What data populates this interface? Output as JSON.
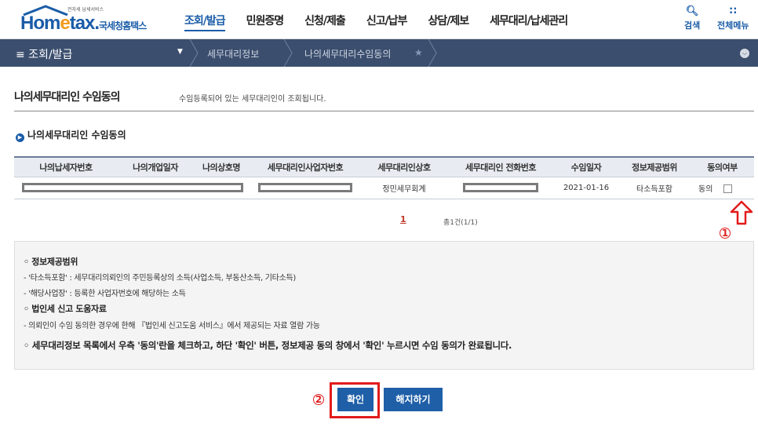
{
  "header": {
    "logo_small": "전자세 납세서비스",
    "logo_main_1": "Hom",
    "logo_main_e": "e",
    "logo_main_2": "tax.",
    "logo_sub": "국세청홈택스",
    "nav": [
      "조회/발급",
      "민원증명",
      "신청/제출",
      "신고/납부",
      "상담/제보",
      "세무대리/납세관리"
    ],
    "active_nav": "조회/발급",
    "search_label": "검색",
    "all_menu_label": "전체메뉴"
  },
  "navbar": {
    "menu_label": "≡  조회/발급",
    "crumb_1": "세무대리정보",
    "crumb_2": "나의세무대리수임동의"
  },
  "page": {
    "title": "나의세무대리인 수임동의",
    "title_desc": "수임등록되어 있는 세무대리인이 조회됩니다.",
    "section_title": "나의세무대리인 수임동의"
  },
  "table": {
    "headers": [
      "나의납세자번호",
      "나의개업일자",
      "나의상호명",
      "세무대리인사업자번호",
      "세무대리인상호",
      "세무대리인 전화번호",
      "수임일자",
      "정보제공범위",
      "동의여부"
    ],
    "row": {
      "agent_name": "정민세무회계",
      "date": "2021-01-16",
      "scope": "타소득포함",
      "consent": "동의"
    }
  },
  "pagination": {
    "page": "1",
    "total": "총1건(1/1)"
  },
  "info": {
    "h1": "◦ 정보제공범위",
    "l1": "- '타소득포함' : 세무대리의뢰인의 주민등록상의 소득(사업소득, 부동산소득, 기타소득)",
    "l2": "- '해당사업장' : 등록한 사업자번호에 해당하는 소득",
    "h2": "◦ 법인세 신고 도움자료",
    "l3": "- 의뢰인이 수임 동의한 경우에 한해 『법인세 신고도움 서비스』에서 제공되는 자료 열람 가능",
    "l4": "◦ 세무대리정보 목록에서 우측 '동의'란을 체크하고, 하단 '확인' 버튼, 정보제공 동의 창에서 '확인' 누르시면 수임 동의가 완료됩니다."
  },
  "buttons": {
    "confirm": "확인",
    "cancel": "해지하기"
  },
  "annotations": {
    "n1": "1",
    "n2": "2"
  },
  "colors": {
    "brand": "#1a5ca8",
    "navbar": "#3b4e6e",
    "annotation_red": "#e21b1b"
  }
}
